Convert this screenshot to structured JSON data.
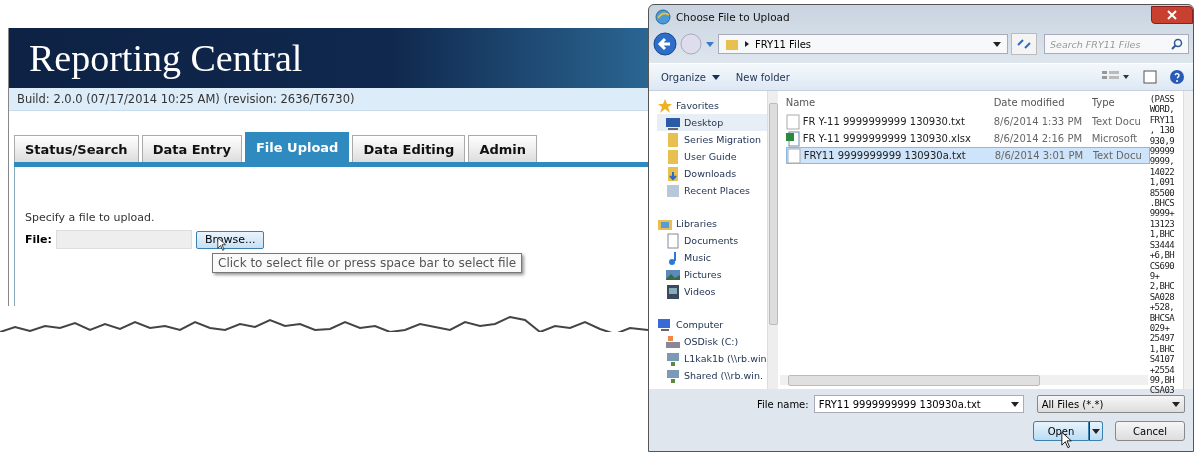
{
  "web_page": {
    "title": "Reporting Central",
    "build_info": "Build: 2.0.0 (07/17/2014 10:25 AM) (revision: 2636/T6730)",
    "tabs": [
      {
        "label": "Status/Search",
        "selected": false
      },
      {
        "label": "Data Entry",
        "selected": false
      },
      {
        "label": "File Upload",
        "selected": true
      },
      {
        "label": "Data Editing",
        "selected": false
      },
      {
        "label": "Admin",
        "selected": false
      }
    ],
    "instruction": "Specify a file to upload.",
    "file_label": "File:",
    "browse_button": "Browse...",
    "tooltip": "Click to select file or press space bar to select file"
  },
  "dialog": {
    "title": "Choose File to Upload",
    "breadcrumb": "FRY11 Files",
    "search": {
      "placeholder": "Search FRY11 Files"
    },
    "toolbar": [
      "Organize",
      "New folder"
    ],
    "nav": [
      {
        "label": "Favorites",
        "kind": "favorites",
        "children": [
          {
            "label": "Desktop",
            "kind": "desktop",
            "selected": true
          },
          {
            "label": "Series Migration",
            "kind": "folder",
            "selected": false
          },
          {
            "label": "User Guide",
            "kind": "folder",
            "selected": false
          },
          {
            "label": "Downloads",
            "kind": "downloads",
            "selected": false
          },
          {
            "label": "Recent Places",
            "kind": "recent",
            "selected": false
          }
        ]
      },
      {
        "label": "Libraries",
        "kind": "libraries",
        "children": [
          {
            "label": "Documents",
            "kind": "documents",
            "selected": false
          },
          {
            "label": "Music",
            "kind": "music",
            "selected": false
          },
          {
            "label": "Pictures",
            "kind": "pictures",
            "selected": false
          },
          {
            "label": "Videos",
            "kind": "videos",
            "selected": false
          }
        ]
      },
      {
        "label": "Computer",
        "kind": "computer",
        "children": [
          {
            "label": "OSDisk (C:)",
            "kind": "disk",
            "selected": false
          },
          {
            "label": "L1kak1b (\\\\rb.win",
            "kind": "network",
            "selected": false
          },
          {
            "label": "Shared (\\\\rb.win.",
            "kind": "network",
            "selected": false
          }
        ]
      }
    ],
    "columns": [
      "Name",
      "Date modified",
      "Type"
    ],
    "files": [
      {
        "name": "FR Y-11 9999999999 130930.txt",
        "date": "8/6/2014 1:33 PM",
        "type": "Text Docu",
        "kind": "txt",
        "selected": false
      },
      {
        "name": "FR Y-11 9999999999 130930.xlsx",
        "date": "8/6/2014 2:16 PM",
        "type": "Microsoft",
        "kind": "xlsx",
        "selected": false
      },
      {
        "name": "FRY11 9999999999 130930a.txt",
        "date": "8/6/2014 3:01 PM",
        "type": "Text Docu",
        "kind": "txt",
        "selected": true
      }
    ],
    "preview_lines": [
      "(PASS",
      "WORD,",
      "FRY11",
      ", 130",
      "930,9",
      "99999",
      "9999,",
      "14022",
      "1,091",
      "85500",
      ".BHCS",
      "9999+",
      "13123",
      "1,BHC",
      "S3444",
      "+6,BH",
      "CS690",
      "9+",
      "2,BHC",
      "SA028",
      "+528,",
      "BHCSA",
      "029+",
      "25497",
      "1,BHC",
      "S4107",
      "+2554",
      "99,BH",
      "CSA03"
    ],
    "file_name_label": "File name:",
    "file_name": "FRY11 9999999999 130930a.txt",
    "filter": "All Files (*.*)",
    "open_button": "Open",
    "cancel_button": "Cancel"
  }
}
